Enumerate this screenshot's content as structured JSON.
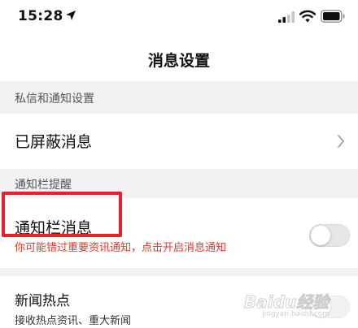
{
  "status_bar": {
    "time": "15:28"
  },
  "nav": {
    "title": "消息设置"
  },
  "sections": {
    "private": {
      "header": "私信和通知设置",
      "blocked_label": "已屏蔽消息"
    },
    "notify_bar": {
      "header": "通知栏提醒",
      "row_label": "通知栏消息",
      "hint": "你可能错过重要资讯通知，点击开启消息通知",
      "toggle_on": false
    },
    "news": {
      "label": "新闻热点",
      "sub": "接收热点资讯、重大新闻",
      "toggle_on": false
    }
  },
  "watermark": {
    "logo": "Baidu经验",
    "sub": "jingyan.baidu.com"
  },
  "colors": {
    "hint_red": "#e0382c",
    "highlight_red": "#e8202a",
    "background": "#f2f2f4"
  }
}
